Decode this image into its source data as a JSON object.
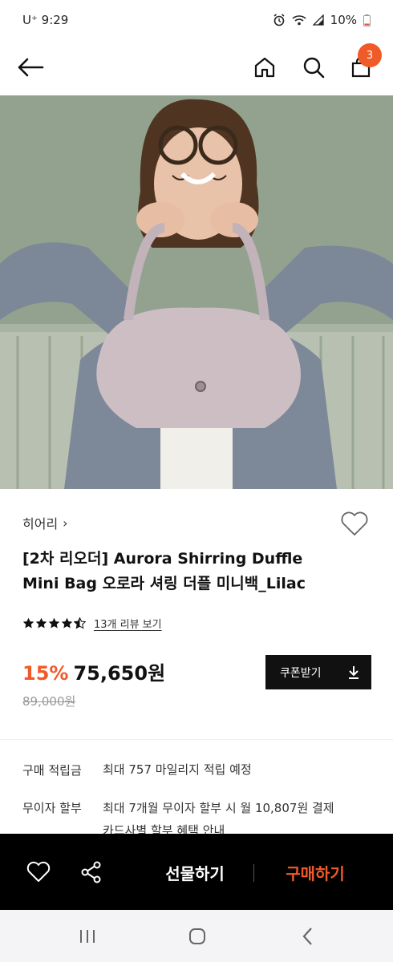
{
  "status_bar": {
    "carrier": "U⁺ 9:29",
    "battery": "10%"
  },
  "header": {
    "cart_count": "3"
  },
  "product": {
    "brand": "히어리",
    "brand_chevron": "›",
    "title_line1": "[2차 리오더] Aurora Shirring Duffle",
    "title_line2": "Mini Bag 오로라 셔링 더플 미니백_Lilac",
    "rating": 4.5,
    "review_link": "13개 리뷰 보기",
    "discount": "15%",
    "price": "75,650원",
    "original_price": "89,000원",
    "coupon_label": "쿠폰받기"
  },
  "info": {
    "points_label": "구매 적립금",
    "points_value": "최대 757 마일리지 적립 예정",
    "installment_label": "무이자 할부",
    "installment_value_line1": "최대 7개월 무이자 할부 시 월 10,807원 결제",
    "installment_value_line2": "카드사별 할부 혜택 안내"
  },
  "bottom_bar": {
    "gift_label": "선물하기",
    "buy_label": "구매하기"
  },
  "colors": {
    "accent": "#f05a28",
    "dark": "#000000"
  }
}
